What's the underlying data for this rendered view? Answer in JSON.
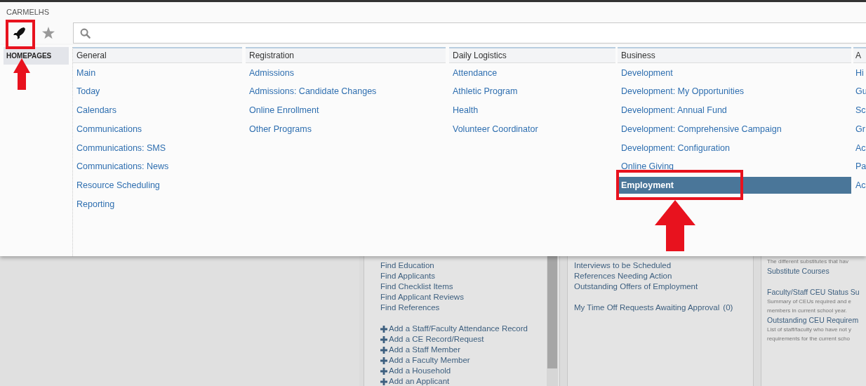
{
  "brand": "CARMELHS",
  "toolbar": {
    "buttons": [
      {
        "kind": "rocket",
        "selected": true
      },
      {
        "kind": "star",
        "selected": false
      }
    ]
  },
  "sidebar": {
    "items": [
      {
        "label": "HOMEPAGES",
        "selected": true
      }
    ]
  },
  "menu": {
    "columns": [
      {
        "heading": "General",
        "items": [
          {
            "label": "Main",
            "selected": false
          },
          {
            "label": "Today",
            "selected": false
          },
          {
            "label": "Calendars",
            "selected": false
          },
          {
            "label": "Communications",
            "selected": false
          },
          {
            "label": "Communications: SMS",
            "selected": false
          },
          {
            "label": "Communications: News",
            "selected": false
          },
          {
            "label": "Resource Scheduling",
            "selected": false
          },
          {
            "label": "Reporting",
            "selected": false
          }
        ]
      },
      {
        "heading": "Registration",
        "items": [
          {
            "label": "Admissions",
            "selected": false
          },
          {
            "label": "Admissions: Candidate Changes",
            "selected": false
          },
          {
            "label": "Online Enrollment",
            "selected": false
          },
          {
            "label": "Other Programs",
            "selected": false
          }
        ]
      },
      {
        "heading": "Daily Logistics",
        "items": [
          {
            "label": "Attendance",
            "selected": false
          },
          {
            "label": "Athletic Program",
            "selected": false
          },
          {
            "label": "Health",
            "selected": false
          },
          {
            "label": "Volunteer Coordinator",
            "selected": false
          }
        ]
      },
      {
        "heading": "Business",
        "items": [
          {
            "label": "Development",
            "selected": false
          },
          {
            "label": "Development: My Opportunities",
            "selected": false
          },
          {
            "label": "Development: Annual Fund",
            "selected": false
          },
          {
            "label": "Development: Comprehensive Campaign",
            "selected": false
          },
          {
            "label": "Development: Configuration",
            "selected": false
          },
          {
            "label": "Online Giving",
            "selected": false
          },
          {
            "label": "Employment",
            "selected": true
          }
        ]
      },
      {
        "heading": "A",
        "items": [
          {
            "label": "Hi",
            "selected": false
          },
          {
            "label": "Gu",
            "selected": false
          },
          {
            "label": "Sc",
            "selected": false
          },
          {
            "label": "Gr",
            "selected": false
          },
          {
            "label": "Ac",
            "selected": false
          },
          {
            "label": "Pa",
            "selected": false
          },
          {
            "label": "Ac",
            "selected": false
          }
        ]
      }
    ]
  },
  "page": {
    "panels": [
      {
        "scrollbar": true,
        "groups": [
          [
            {
              "kind": "link",
              "text": "Find Education"
            },
            {
              "kind": "link",
              "text": "Find Applicants"
            },
            {
              "kind": "link",
              "text": "Find Checklist Items"
            },
            {
              "kind": "link",
              "text": "Find Applicant Reviews"
            },
            {
              "kind": "link",
              "text": "Find References"
            }
          ],
          [
            {
              "kind": "add",
              "text": "Add a Staff/Faculty Attendance Record"
            },
            {
              "kind": "add",
              "text": "Add a CE Record/Request"
            },
            {
              "kind": "add",
              "text": "Add a Staff Member"
            },
            {
              "kind": "add",
              "text": "Add a Faculty Member"
            },
            {
              "kind": "add",
              "text": "Add a Household"
            },
            {
              "kind": "add",
              "text": "Add an Applicant"
            }
          ]
        ]
      },
      {
        "scrollbar": false,
        "groups": [
          [
            {
              "kind": "link",
              "text": "Interviews to be Scheduled"
            },
            {
              "kind": "link",
              "text": "References Needing Action"
            },
            {
              "kind": "link",
              "text": "Outstanding Offers of Employment"
            }
          ],
          [
            {
              "kind": "link",
              "text": "My Time Off Requests Awaiting Approval",
              "count": "(0)"
            }
          ]
        ]
      },
      {
        "scrollbar": false,
        "groups": [
          [
            {
              "kind": "note",
              "text": "The different substitutes that hav"
            },
            {
              "kind": "link",
              "text": "Substitute Courses"
            }
          ],
          [
            {
              "kind": "link",
              "text": "Faculty/Staff CEU Status Su"
            },
            {
              "kind": "note",
              "text": "Summary of CEUs required and e"
            },
            {
              "kind": "note",
              "text": "members in current school year."
            },
            {
              "kind": "link",
              "text": "Outstanding CEU Requirem"
            },
            {
              "kind": "note",
              "text": "List of staff/faculty who have not y"
            },
            {
              "kind": "note",
              "text": "requirements for the current scho"
            }
          ]
        ]
      }
    ]
  }
}
